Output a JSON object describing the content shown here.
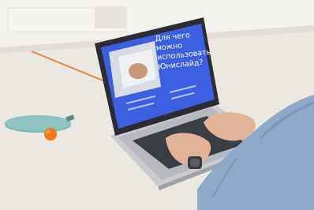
{
  "scene": {
    "slide_title": "Для чего\nможно\nиспользовать\nЮнислайд?",
    "colors": {
      "wall": "#f1efeb",
      "table": "#ece9e3",
      "table_edge": "#c9c4bb",
      "orange_line": "#e58a3b",
      "laptop_body": "#2b2d33",
      "laptop_base": "#c9cbcf",
      "screen_blue": "#3a5fe0",
      "skin": "#e2b396",
      "sleeve": "#8fa9c9",
      "paddle": "#7ab8b2",
      "ball": "#f27a1a"
    }
  }
}
